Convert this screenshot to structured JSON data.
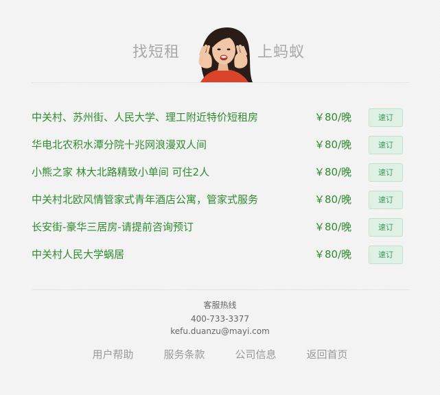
{
  "header": {
    "slogan_left": "找短租",
    "slogan_right": "上蚂蚁"
  },
  "listings": [
    {
      "title": "中关村、苏州街、人民大学、理工附近特价短租房",
      "price": "￥80/晚",
      "action": "速订"
    },
    {
      "title": "华电北农积水潭分院十兆网浪漫双人间",
      "price": "￥80/晚",
      "action": "速订"
    },
    {
      "title": "小熊之家 林大北路精致小单间 可住2人",
      "price": "￥80/晚",
      "action": "速订"
    },
    {
      "title": "中关村北欧风情管家式青年酒店公寓，管家式服务",
      "price": "￥80/晚",
      "action": "速订"
    },
    {
      "title": "长安街-豪华三居房-请提前咨询预订",
      "price": "￥80/晚",
      "action": "速订"
    },
    {
      "title": "中关村人民大学蜗居",
      "price": "￥80/晚",
      "action": "速订"
    }
  ],
  "footer": {
    "hotline_label": "客服热线",
    "phone": "400-733-3377",
    "email": "kefu.duanzu@mayi.com",
    "links": [
      "用户帮助",
      "服务条款",
      "公司信息",
      "返回首页"
    ]
  },
  "colors": {
    "listing_text": "#2e8b2e",
    "button_bg": "#dff0e4",
    "slogan": "#a8a8a8"
  }
}
